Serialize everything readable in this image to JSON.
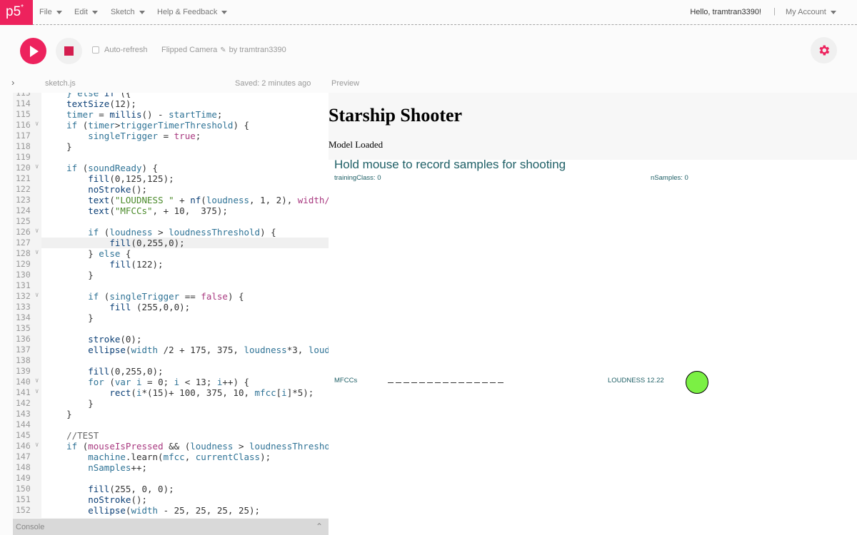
{
  "app": {
    "logo": "p5",
    "logo_mark": "*"
  },
  "nav": {
    "menus": [
      "File",
      "Edit",
      "Sketch",
      "Help & Feedback"
    ],
    "greeting": "Hello, tramtran3390!",
    "separator": "|",
    "account": "My Account"
  },
  "toolbar": {
    "auto_refresh": "Auto-refresh",
    "project_name": "Flipped Camera",
    "by_user": "by tramtran3390"
  },
  "editor": {
    "filename": "sketch.js",
    "saved": "Saved: 2 minutes ago",
    "preview_label": "Preview",
    "console_label": "Console",
    "active_line": 127,
    "lines": [
      {
        "n": "113",
        "code": "    <span class='k'>} else</span> <span class='f'>if</span> ({"
      },
      {
        "n": "114",
        "code": "    <span class='f'>textSize</span>(12);"
      },
      {
        "n": "115",
        "code": "    <span class='k'>timer</span> = <span class='f'>millis</span>() - <span class='k'>startTime</span>;"
      },
      {
        "n": "116",
        "fold": true,
        "code": "    <span class='k'>if</span> (<span class='k'>timer</span>&gt;<span class='k'>triggerTimerThreshold</span>) {"
      },
      {
        "n": "117",
        "code": "        <span class='k'>singleTrigger</span> = <span class='m'>true</span>;"
      },
      {
        "n": "118",
        "code": "    }"
      },
      {
        "n": "119",
        "code": ""
      },
      {
        "n": "120",
        "fold": true,
        "code": "    <span class='k'>if</span> (<span class='k'>soundReady</span>) {"
      },
      {
        "n": "121",
        "code": "        <span class='f'>fill</span>(0,125,125);"
      },
      {
        "n": "122",
        "code": "        <span class='f'>noStroke</span>();"
      },
      {
        "n": "123",
        "code": "        <span class='f'>text</span>(<span class='s'>\"LOUDNESS \"</span> + <span class='f'>nf</span>(<span class='k'>loudness</span>, 1, 2), <span class='m'>width/</span>"
      },
      {
        "n": "124",
        "code": "        <span class='f'>text</span>(<span class='s'>\"MFCCs\"</span>, + 10,  375);"
      },
      {
        "n": "125",
        "code": ""
      },
      {
        "n": "126",
        "fold": true,
        "code": "        <span class='k'>if</span> (<span class='k'>loudness</span> &gt; <span class='k'>loudnessThreshold</span>) {"
      },
      {
        "n": "127",
        "code": "            <span class='f'>fill</span>(0,255,0);"
      },
      {
        "n": "128",
        "fold": true,
        "code": "        } <span class='k'>else</span> {"
      },
      {
        "n": "129",
        "code": "            <span class='f'>fill</span>(122);"
      },
      {
        "n": "130",
        "code": "        }"
      },
      {
        "n": "131",
        "code": ""
      },
      {
        "n": "132",
        "fold": true,
        "code": "        <span class='k'>if</span> (<span class='k'>singleTrigger</span> == <span class='m'>false</span>) {"
      },
      {
        "n": "133",
        "code": "            <span class='f'>fill</span> (255,0,0);"
      },
      {
        "n": "134",
        "code": "        }"
      },
      {
        "n": "135",
        "code": ""
      },
      {
        "n": "136",
        "code": "        <span class='f'>stroke</span>(0);"
      },
      {
        "n": "137",
        "code": "        <span class='f'>ellipse</span>(<span class='k'>width</span> /2 + 175, 375, <span class='k'>loudness</span>*3, <span class='k'>loud</span>"
      },
      {
        "n": "138",
        "code": ""
      },
      {
        "n": "139",
        "code": "        <span class='f'>fill</span>(0,255,0);"
      },
      {
        "n": "140",
        "fold": true,
        "code": "        <span class='k'>for</span> (<span class='k'>var</span> <span class='k'>i</span> = 0; <span class='k'>i</span> &lt; 13; <span class='k'>i</span>++) {"
      },
      {
        "n": "141",
        "fold": true,
        "code": "            <span class='f'>rect</span>(<span class='k'>i</span>*(15)+ 100, 375, 10, <span class='k'>mfcc</span>[<span class='k'>i</span>]*5);"
      },
      {
        "n": "142",
        "code": "        }"
      },
      {
        "n": "143",
        "code": "    }"
      },
      {
        "n": "144",
        "code": ""
      },
      {
        "n": "145",
        "code": "    <span class='c'>//TEST</span>"
      },
      {
        "n": "146",
        "fold": true,
        "code": "    <span class='k'>if</span> (<span class='m'>mouseIsPressed</span> &amp;&amp; (<span class='k'>loudness</span> &gt; <span class='k'>loudnessThresho</span>"
      },
      {
        "n": "147",
        "code": "        <span class='k'>machine</span>.learn(<span class='k'>mfcc</span>, <span class='k'>currentClass</span>);"
      },
      {
        "n": "148",
        "code": "        <span class='k'>nSamples</span>++;"
      },
      {
        "n": "149",
        "code": ""
      },
      {
        "n": "150",
        "code": "        <span class='f'>fill</span>(255, 0, 0);"
      },
      {
        "n": "151",
        "code": "        <span class='f'>noStroke</span>();"
      },
      {
        "n": "152",
        "code": "        <span class='f'>ellipse</span>(<span class='k'>width</span> - 25, 25, 25, 25);"
      }
    ]
  },
  "preview": {
    "title": "Starship Shooter",
    "status": "Model Loaded",
    "instruction": "Hold mouse to record samples for shooting",
    "training_class": "trainingClass: 0",
    "n_samples": "nSamples: 0",
    "mfcc_label": "MFCCs",
    "loudness_label": "LOUDNESS 12.22",
    "mfcc_bar_count": 15,
    "ball_color": "#7bf044"
  },
  "colors": {
    "accent": "#ed225d"
  }
}
